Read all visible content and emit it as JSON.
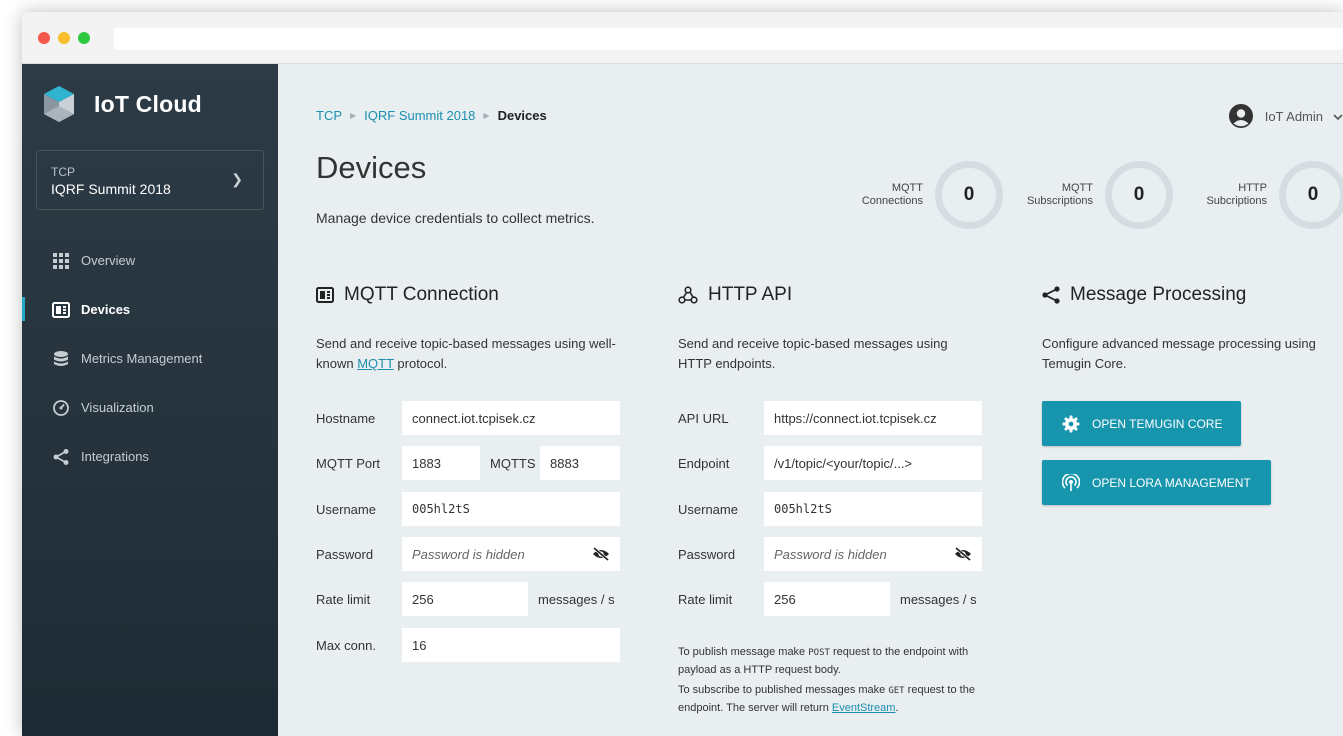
{
  "app": {
    "name": "IoT Cloud"
  },
  "context": {
    "org": "TCP",
    "project": "IQRF Summit 2018"
  },
  "nav": {
    "items": [
      {
        "label": "Overview",
        "icon": "grid-icon"
      },
      {
        "label": "Devices",
        "icon": "device-icon",
        "active": true
      },
      {
        "label": "Metrics Management",
        "icon": "database-icon"
      },
      {
        "label": "Visualization",
        "icon": "gauge-icon"
      },
      {
        "label": "Integrations",
        "icon": "share-icon"
      }
    ]
  },
  "breadcrumb": {
    "items": [
      "TCP",
      "IQRF Summit 2018"
    ],
    "current": "Devices"
  },
  "user": {
    "name": "IoT Admin"
  },
  "page": {
    "title": "Devices",
    "subtitle": "Manage device credentials to collect metrics."
  },
  "stats": [
    {
      "label1": "MQTT",
      "label2": "Connections",
      "value": "0"
    },
    {
      "label1": "MQTT",
      "label2": "Subscriptions",
      "value": "0"
    },
    {
      "label1": "HTTP",
      "label2": "Subcriptions",
      "value": "0"
    }
  ],
  "mqtt": {
    "title": "MQTT Connection",
    "desc_before": "Send and receive topic-based messages using well-known ",
    "desc_link": "MQTT",
    "desc_after": " protocol.",
    "hostname_label": "Hostname",
    "hostname": "connect.iot.tcpisek.cz",
    "port_label": "MQTT Port",
    "port": "1883",
    "mqtts_label": "MQTTS",
    "mqtts": "8883",
    "username_label": "Username",
    "username": "005hl2tS",
    "password_label": "Password",
    "password": "Password is hidden",
    "rate_label": "Rate limit",
    "rate": "256",
    "rate_unit": "messages / s",
    "maxconn_label": "Max conn.",
    "maxconn": "16"
  },
  "http": {
    "title": "HTTP API",
    "desc": "Send and receive topic-based messages using HTTP endpoints.",
    "url_label": "API URL",
    "url": "https://connect.iot.tcpisek.cz",
    "endpoint_label": "Endpoint",
    "endpoint": "/v1/topic/<your/topic/...>",
    "username_label": "Username",
    "username": "005hl2tS",
    "password_label": "Password",
    "password": "Password is hidden",
    "rate_label": "Rate limit",
    "rate": "256",
    "rate_unit": "messages / s",
    "note1_a": "To publish message make ",
    "note1_code": "POST",
    "note1_b": " request to the endpoint with payload as a HTTP request body.",
    "note2_a": "To subscribe to published messages make ",
    "note2_code": "GET",
    "note2_b": " request to the endpoint. The server will return ",
    "note2_link": "EventStream",
    "note2_c": "."
  },
  "processing": {
    "title": "Message Processing",
    "desc": "Configure advanced message processing using Temugin Core.",
    "btn_temugin": "OPEN TEMUGIN CORE",
    "btn_lora": "OPEN LORA MANAGEMENT"
  },
  "colors": {
    "accent": "#1795ad",
    "link": "#1a8fae",
    "sidebar": "#2a3741",
    "background": "#e9eef1"
  }
}
